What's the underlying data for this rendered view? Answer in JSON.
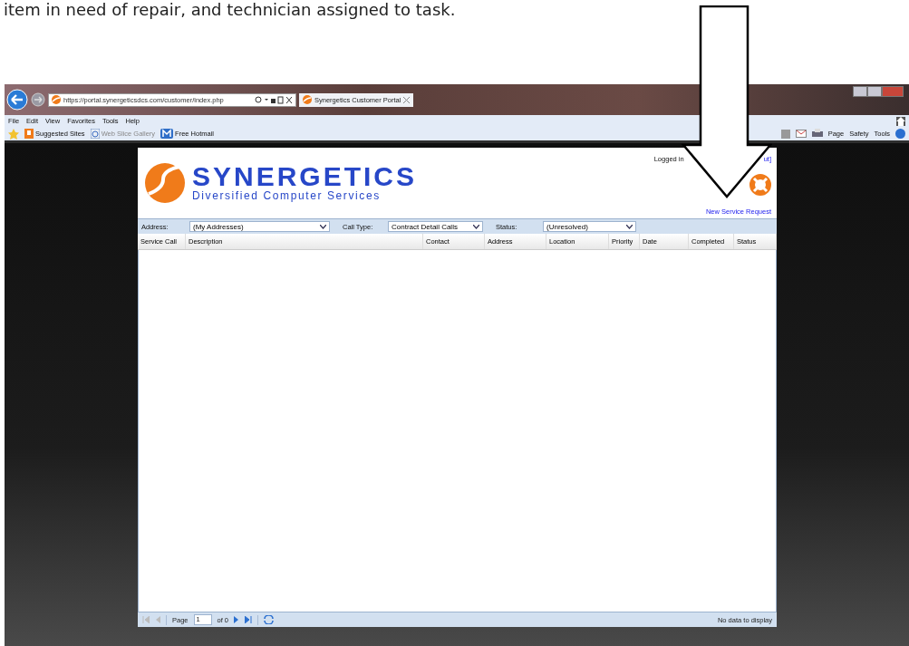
{
  "caption": "item in need of repair, and technician assigned to task.",
  "browser": {
    "address": "https://portal.synergeticsdcs.com/customer/index.php",
    "tab": "Synergetics Customer Portal",
    "menu": [
      "File",
      "Edit",
      "View",
      "Favorites",
      "Tools",
      "Help"
    ],
    "favorites": [
      {
        "label": "Suggested Sites",
        "kind": "site",
        "disabled": false
      },
      {
        "label": "Web Slice Gallery",
        "kind": "gallery",
        "disabled": true
      },
      {
        "label": "Free Hotmail",
        "kind": "mail",
        "disabled": false
      }
    ],
    "commands": [
      "Page",
      "Safety",
      "Tools"
    ]
  },
  "portal": {
    "logo": {
      "name": "SYNERGETICS",
      "tagline": "Diversified Computer Services"
    },
    "login_text": "Logged in",
    "logout_fragment": "ut]",
    "new_request": "New Service Request",
    "filters": [
      {
        "label": "Address:",
        "value": "(My Addresses)"
      },
      {
        "label": "Call Type:",
        "value": "Contract Detail Calls"
      },
      {
        "label": "Status:",
        "value": "(Unresolved)"
      }
    ],
    "columns": [
      "Service Call",
      "Description",
      "Contact",
      "Address",
      "Location",
      "Priority",
      "Date",
      "Completed",
      "Status"
    ],
    "pager": {
      "label": "Page",
      "page": "1",
      "of": "of 0",
      "message": "No data to display"
    }
  }
}
